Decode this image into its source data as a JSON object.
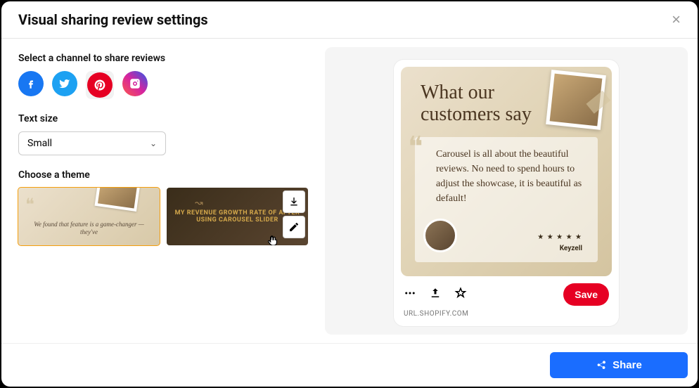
{
  "modal": {
    "title": "Visual sharing review settings",
    "close_label": "×"
  },
  "channel_section": {
    "label": "Select a channel to share reviews",
    "items": [
      {
        "name": "facebook"
      },
      {
        "name": "twitter"
      },
      {
        "name": "pinterest",
        "selected": true
      },
      {
        "name": "instagram"
      }
    ]
  },
  "text_size": {
    "label": "Text size",
    "value": "Small"
  },
  "theme_section": {
    "label": "Choose a theme",
    "themes": [
      {
        "preview_text": "We found that feature is a game-changer — they've",
        "selected": true
      },
      {
        "preview_text": "MY REVENUE GROWTH RATE OF AFTER USING CAROUSEL SLIDER"
      }
    ]
  },
  "preview": {
    "heading_line1": "What our",
    "heading_line2": "customers say",
    "review_text": "Carousel is all about the beautiful reviews. No need to spend hours to adjust the showcase, it is beautiful as default!",
    "stars": "★ ★ ★ ★ ★",
    "author": "Keyzell",
    "url": "URL.SHOPIFY.COM",
    "save_label": "Save"
  },
  "footer": {
    "share_label": "Share"
  }
}
